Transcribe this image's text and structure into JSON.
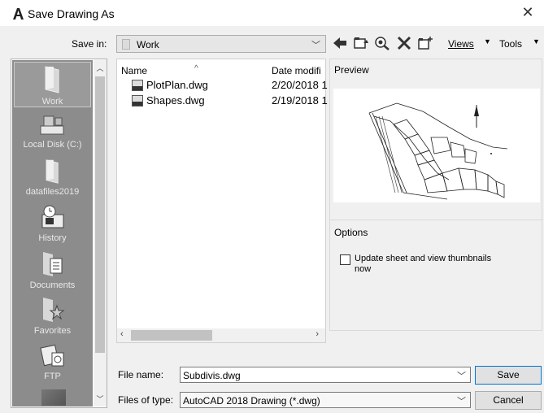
{
  "window": {
    "title": "Save Drawing As",
    "close_glyph": "✕"
  },
  "save_in": {
    "label": "Save in:",
    "value": "Work"
  },
  "toolbar": {
    "views_label": "Views",
    "tools_label": "Tools",
    "icons": [
      "back-arrow-icon",
      "up-folder-icon",
      "search-web-icon",
      "delete-icon",
      "new-folder-icon"
    ]
  },
  "places": [
    {
      "label": "Work",
      "icon": "folder-icon"
    },
    {
      "label": "Local Disk (C:)",
      "icon": "hard-disk-icon"
    },
    {
      "label": "datafiles2019",
      "icon": "folder-icon"
    },
    {
      "label": "History",
      "icon": "history-icon"
    },
    {
      "label": "Documents",
      "icon": "documents-icon"
    },
    {
      "label": "Favorites",
      "icon": "favorites-icon"
    },
    {
      "label": "FTP",
      "icon": "ftp-icon"
    }
  ],
  "filelist": {
    "col_name": "Name",
    "col_date": "Date modifi",
    "files": [
      {
        "name": "PlotPlan.dwg",
        "date": "2/20/2018 1"
      },
      {
        "name": "Shapes.dwg",
        "date": "2/19/2018 1"
      }
    ]
  },
  "preview": {
    "label": "Preview"
  },
  "options": {
    "label": "Options",
    "thumbnail_checkbox_label": "Update sheet and view thumbnails now",
    "thumbnail_checked": false
  },
  "file_name": {
    "label": "File name:",
    "value": "Subdivis.dwg"
  },
  "file_type": {
    "label": "Files of type:",
    "value": "AutoCAD 2018 Drawing (*.dwg)"
  },
  "buttons": {
    "save": "Save",
    "cancel": "Cancel"
  },
  "colors": {
    "places_bg": "#8c8c8c",
    "window_bg": "#f0f0f0"
  }
}
